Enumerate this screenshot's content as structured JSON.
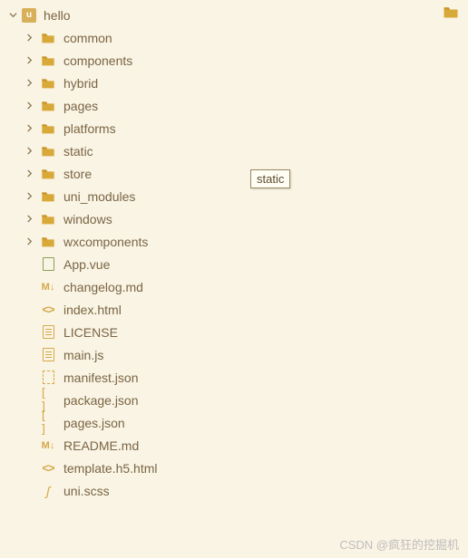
{
  "root": {
    "name": "hello",
    "icon_letter": "u"
  },
  "folders": [
    {
      "name": "common"
    },
    {
      "name": "components"
    },
    {
      "name": "hybrid"
    },
    {
      "name": "pages"
    },
    {
      "name": "platforms"
    },
    {
      "name": "static"
    },
    {
      "name": "store"
    },
    {
      "name": "uni_modules"
    },
    {
      "name": "windows"
    },
    {
      "name": "wxcomponents"
    }
  ],
  "files": [
    {
      "name": "App.vue",
      "icon": "vue"
    },
    {
      "name": "changelog.md",
      "icon": "md"
    },
    {
      "name": "index.html",
      "icon": "html"
    },
    {
      "name": "LICENSE",
      "icon": "doc"
    },
    {
      "name": "main.js",
      "icon": "doc"
    },
    {
      "name": "manifest.json",
      "icon": "manifest"
    },
    {
      "name": "package.json",
      "icon": "json"
    },
    {
      "name": "pages.json",
      "icon": "json"
    },
    {
      "name": "README.md",
      "icon": "md"
    },
    {
      "name": "template.h5.html",
      "icon": "html"
    },
    {
      "name": "uni.scss",
      "icon": "scss"
    }
  ],
  "tooltip": "static",
  "watermark": "CSDN @疯狂的挖掘机",
  "colors": {
    "bg": "#faf4e4",
    "text": "#7a6545",
    "folder": "#d8a839",
    "folder_tab": "#c79528"
  }
}
